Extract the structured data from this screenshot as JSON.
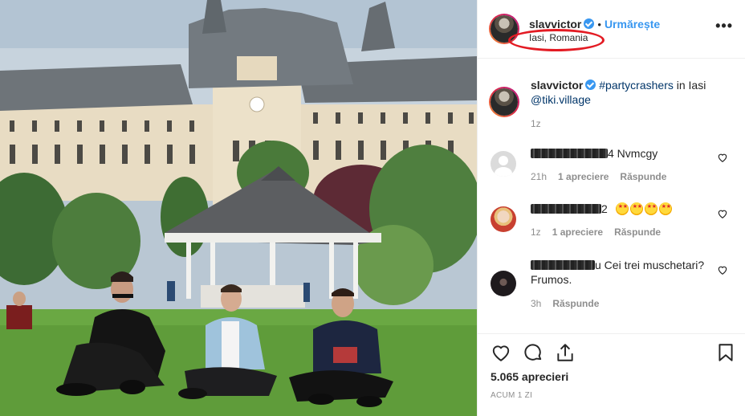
{
  "post": {
    "username": "slavvictor",
    "follow_label": "Urmărește",
    "separator": "•",
    "location": "Iasi, Romania",
    "more_label": "•••"
  },
  "caption": {
    "username": "slavvictor",
    "hashtag": "#partycrashers",
    "text_mid": " in Iasi ",
    "mention": "@tiki.village",
    "time": "1z"
  },
  "comments": [
    {
      "text": "4 Nvmcgy",
      "time": "21h",
      "likes": "1 apreciere",
      "reply": "Răspunde"
    },
    {
      "text": "2",
      "time": "1z",
      "likes": "1 apreciere",
      "reply": "Răspunde"
    },
    {
      "text": "u Cei trei muschetari? Frumos.",
      "time": "3h",
      "reply": "Răspunde"
    }
  ],
  "actions": {
    "likes_count": "5.065 aprecieri",
    "time_ago": "ACUM 1 ZI"
  },
  "icons": {
    "verified": "verified-badge-icon",
    "like": "heart-icon",
    "comment": "comment-bubble-icon",
    "share": "share-icon",
    "save": "bookmark-icon",
    "more": "more-options-icon"
  },
  "colors": {
    "link_blue": "#3897f0",
    "mention_blue": "#003569",
    "annotation_red": "#e31b23",
    "meta_grey": "#8e8e8e"
  }
}
